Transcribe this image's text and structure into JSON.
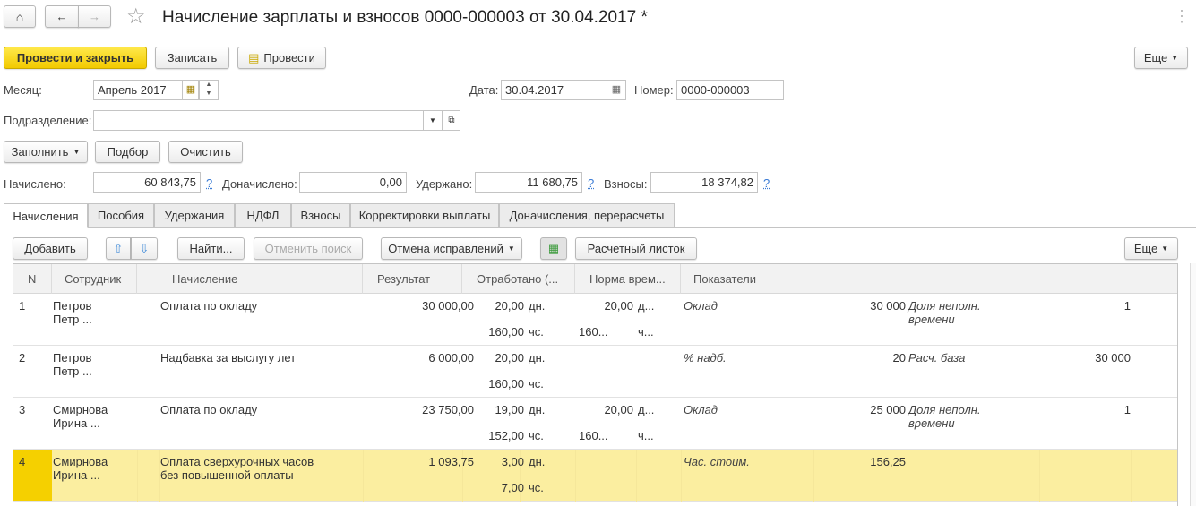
{
  "header": {
    "title": "Начисление зарплаты и взносов 0000-000003 от 30.04.2017 *"
  },
  "toolbar": {
    "post_close": "Провести и закрыть",
    "save": "Записать",
    "post": "Провести",
    "more": "Еще"
  },
  "form": {
    "month_label": "Месяц:",
    "month_value": "Апрель 2017",
    "date_label": "Дата:",
    "date_value": "30.04.2017",
    "number_label": "Номер:",
    "number_value": "0000-000003",
    "division_label": "Подразделение:",
    "division_value": "",
    "fill": "Заполнить",
    "pick": "Подбор",
    "clear": "Очистить",
    "accrued_label": "Начислено:",
    "accrued_value": "60 843,75",
    "extra_label": "Доначислено:",
    "extra_value": "0,00",
    "withheld_label": "Удержано:",
    "withheld_value": "11 680,75",
    "contrib_label": "Взносы:",
    "contrib_value": "18 374,82",
    "help": "?"
  },
  "tabs": [
    "Начисления",
    "Пособия",
    "Удержания",
    "НДФЛ",
    "Взносы",
    "Корректировки выплаты",
    "Доначисления, перерасчеты"
  ],
  "grid_toolbar": {
    "add": "Добавить",
    "find": "Найти...",
    "cancel_search": "Отменить поиск",
    "undo_fixes": "Отмена исправлений",
    "payslip": "Расчетный листок",
    "more": "Еще"
  },
  "columns": [
    "N",
    "Сотрудник",
    "",
    "Начисление",
    "Результат",
    "Отработано (...",
    "Норма врем...",
    "Показатели"
  ],
  "rows": [
    {
      "n": "1",
      "emp1": "Петров",
      "emp2": "Петр ...",
      "acc1": "Оплата по окладу",
      "acc2": "",
      "result": "30 000,00",
      "w1": "20,00",
      "wu1": "дн.",
      "w2": "160,00",
      "wu2": "чс.",
      "n1": "20,00",
      "nu1": "д...",
      "n2": "160...",
      "nu2": "ч...",
      "p1": "Оклад",
      "pv1": "30 000",
      "p2a": "Доля неполн.",
      "p2b": "времени",
      "pv2": "1"
    },
    {
      "n": "2",
      "emp1": "Петров",
      "emp2": "Петр ...",
      "acc1": "Надбавка за выслугу лет",
      "acc2": "",
      "result": "6 000,00",
      "w1": "20,00",
      "wu1": "дн.",
      "w2": "160,00",
      "wu2": "чс.",
      "n1": "",
      "nu1": "",
      "n2": "",
      "nu2": "",
      "p1": "% надб.",
      "pv1": "20",
      "p2a": "Расч. база",
      "p2b": "",
      "pv2": "30 000"
    },
    {
      "n": "3",
      "emp1": "Смирнова",
      "emp2": "Ирина ...",
      "acc1": "Оплата по окладу",
      "acc2": "",
      "result": "23 750,00",
      "w1": "19,00",
      "wu1": "дн.",
      "w2": "152,00",
      "wu2": "чс.",
      "n1": "20,00",
      "nu1": "д...",
      "n2": "160...",
      "nu2": "ч...",
      "p1": "Оклад",
      "pv1": "25 000",
      "p2a": "Доля неполн.",
      "p2b": "времени",
      "pv2": "1"
    },
    {
      "n": "4",
      "emp1": "Смирнова",
      "emp2": "Ирина ...",
      "acc1": "Оплата сверхурочных часов",
      "acc2": "без повышенной оплаты",
      "result": "1 093,75",
      "w1": "3,00",
      "wu1": "дн.",
      "w2": "7,00",
      "wu2": "чс.",
      "n1": "",
      "nu1": "",
      "n2": "",
      "nu2": "",
      "p1": "Час. стоим.",
      "pv1": "156,25",
      "p2a": "",
      "p2b": "",
      "pv2": "",
      "selected": true
    }
  ]
}
